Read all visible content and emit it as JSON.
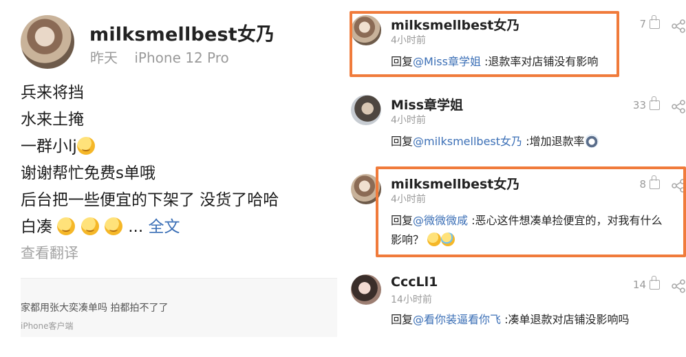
{
  "post": {
    "username": "milksmellbest女乃",
    "date": "昨天",
    "device": "iPhone 12 Pro",
    "lines": [
      "兵来将挡",
      "水来土掩",
      "一群小lj",
      "谢谢帮忙免费s单哦",
      "后台把一些便宜的下架了 没货了哈哈",
      "白凑"
    ],
    "more_ellipsis": "...",
    "more_link": "全文",
    "translate": "查看翻译",
    "repost_text": "家都用张大奕凑单吗 拍都拍不了了",
    "repost_source": "iPhone客户端"
  },
  "comments": [
    {
      "username": "milksmellbest女乃",
      "time": "4小时前",
      "reply_prefix": "回复",
      "mention": "@Miss章学姐",
      "text": " :退款率对店铺没有影响",
      "likes": "7",
      "highlighted": true
    },
    {
      "username": "Miss章学姐",
      "time": "4小时前",
      "reply_prefix": "回复",
      "mention": "@milksmellbest女乃",
      "text": " :增加退款率",
      "likes": "33",
      "highlighted": false
    },
    {
      "username": "milksmellbest女乃",
      "time": "4小时前",
      "reply_prefix": "回复",
      "mention": "@微微微咸",
      "text": " :恶心这件想凑单捡便宜的，对我有什么",
      "text_line2": "影响？",
      "likes": "8",
      "highlighted": true
    },
    {
      "username": "CccLl1",
      "time": "14小时前",
      "reply_prefix": "回复",
      "mention": "@看你装逼看你飞",
      "text": " :凑单退款对店铺没影响吗",
      "likes": "14",
      "highlighted": false
    }
  ],
  "icons": {
    "like": "thumbs-up-icon",
    "share": "share-icon"
  },
  "colors": {
    "highlight_border": "#f07b3b",
    "mention": "#3b6fb6",
    "muted": "#9a9a9a"
  }
}
